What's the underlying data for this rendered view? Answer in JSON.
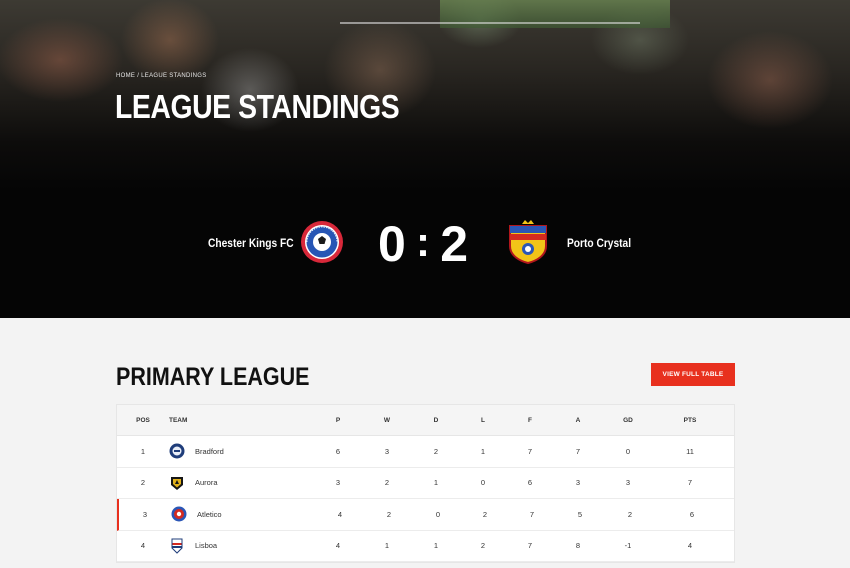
{
  "breadcrumb": {
    "home": "HOME",
    "separator": "/",
    "current": "LEAGUE STANDINGS"
  },
  "page_title": "LEAGUE STANDINGS",
  "match": {
    "home_team": "Chester Kings FC",
    "away_team": "Porto Crystal",
    "home_score": "0",
    "separator": ":",
    "away_score": "2"
  },
  "league": {
    "title": "PRIMARY LEAGUE",
    "button_label": "VIEW FULL TABLE"
  },
  "table": {
    "headers": {
      "pos": "POS",
      "team": "TEAM",
      "p": "P",
      "w": "W",
      "d": "D",
      "l": "L",
      "f": "F",
      "a": "A",
      "gd": "GD",
      "pts": "PTS"
    },
    "rows": [
      {
        "pos": "1",
        "team": "Bradford",
        "p": "6",
        "w": "3",
        "d": "2",
        "l": "1",
        "f": "7",
        "a": "7",
        "gd": "0",
        "pts": "11"
      },
      {
        "pos": "2",
        "team": "Aurora",
        "p": "3",
        "w": "2",
        "d": "1",
        "l": "0",
        "f": "6",
        "a": "3",
        "gd": "3",
        "pts": "7"
      },
      {
        "pos": "3",
        "team": "Atletico",
        "p": "4",
        "w": "2",
        "d": "0",
        "l": "2",
        "f": "7",
        "a": "5",
        "gd": "2",
        "pts": "6"
      },
      {
        "pos": "4",
        "team": "Lisboa",
        "p": "4",
        "w": "1",
        "d": "1",
        "l": "2",
        "f": "7",
        "a": "8",
        "gd": "-1",
        "pts": "4"
      }
    ]
  },
  "colors": {
    "accent": "#e8301e",
    "hero_bg": "#050505",
    "page_bg": "#f3f3f3"
  }
}
